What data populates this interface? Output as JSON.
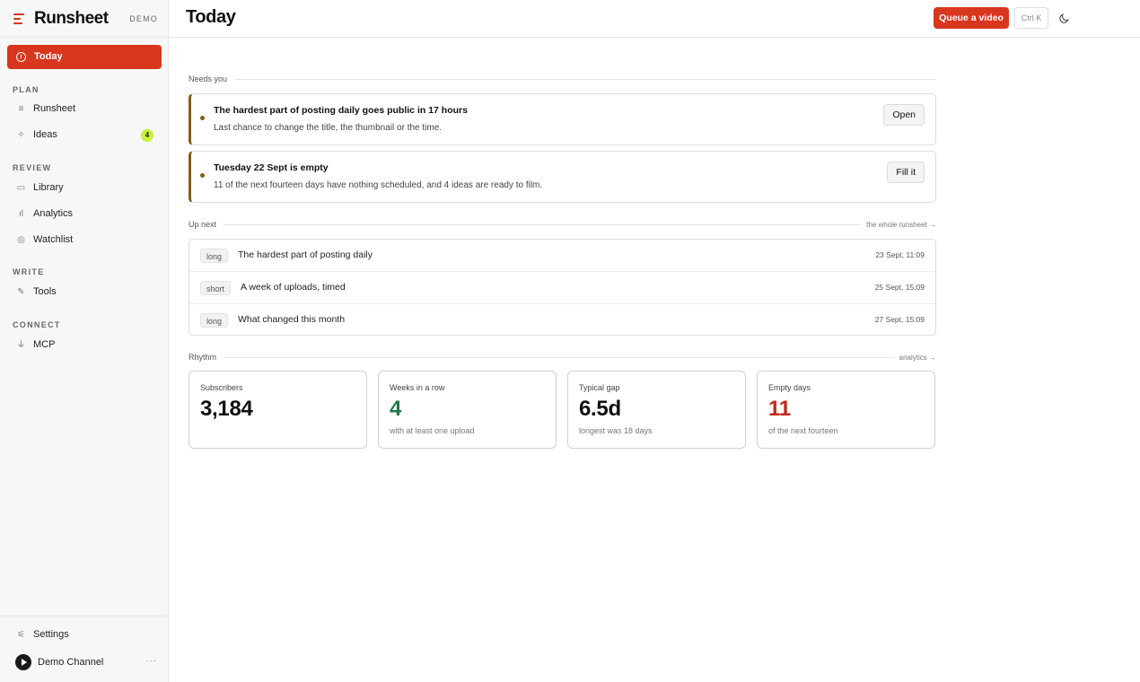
{
  "brand": {
    "name": "Runsheet",
    "badge": "DEMO"
  },
  "sidebar": {
    "active": {
      "label": "Today"
    },
    "sections": {
      "plan": "PLAN",
      "review": "REVIEW",
      "write": "WRITE",
      "connect": "CONNECT"
    },
    "items": {
      "runsheet": "Runsheet",
      "ideas": "Ideas",
      "ideas_count": "4",
      "library": "Library",
      "analytics": "Analytics",
      "watchlist": "Watchlist",
      "tools": "Tools",
      "mcp": "MCP"
    },
    "settings": "Settings",
    "channel": {
      "name": "Demo Channel",
      "more": "···"
    }
  },
  "header": {
    "title": "Today",
    "queue_button": "Queue a video",
    "shortcut": "Ctrl K"
  },
  "needs_you": {
    "label": "Needs you",
    "alerts": [
      {
        "title": "The hardest part of posting daily goes public in 17 hours",
        "subtitle": "Last chance to change the title, the thumbnail or the time.",
        "action": "Open"
      },
      {
        "title": "Tuesday 22 Sept is empty",
        "subtitle": "11 of the next fourteen days have nothing scheduled, and 4 ideas are ready to film.",
        "action": "Fill it"
      }
    ]
  },
  "up_next": {
    "label": "Up next",
    "link": "the whole runsheet →",
    "rows": [
      {
        "tag": "long",
        "title": "The hardest part of posting daily",
        "when": "23 Sept, 11:09"
      },
      {
        "tag": "short",
        "title": "A week of uploads, timed",
        "when": "25 Sept, 15:09"
      },
      {
        "tag": "long",
        "title": "What changed this month",
        "when": "27 Sept, 15:09"
      }
    ]
  },
  "rhythm": {
    "label": "Rhythm",
    "link": "analytics →",
    "cards": [
      {
        "label": "Subscribers",
        "value": "3,184",
        "note": ""
      },
      {
        "label": "Weeks in a row",
        "value": "4",
        "note": "with at least one upload"
      },
      {
        "label": "Typical gap",
        "value": "6.5d",
        "note": "longest was 18 days"
      },
      {
        "label": "Empty days",
        "value": "11",
        "note": "of the next fourteen"
      }
    ]
  },
  "colors": {
    "accent": "#d9361e",
    "alert_border": "#8a5a12",
    "positive": "#1f7a4a",
    "negative": "#c0281a",
    "badge": "#c7f03a"
  }
}
